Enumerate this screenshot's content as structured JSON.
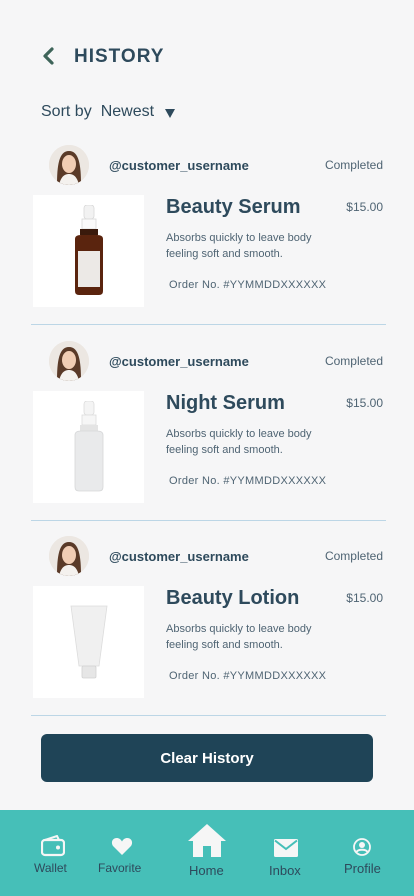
{
  "header": {
    "title": "HISTORY",
    "back_icon": "chevron-left-icon"
  },
  "sort": {
    "label": "Sort by",
    "value": "Newest"
  },
  "orders": [
    {
      "username": "@customer_username",
      "status": "Completed",
      "product_name": "Beauty Serum",
      "price": "$15.00",
      "description": "Absorbs quickly to leave body feeling soft and smooth.",
      "order_no": "Order No. #YYMMDDXXXXXX",
      "product_icon": "amber-dropper-bottle"
    },
    {
      "username": "@customer_username",
      "status": "Completed",
      "product_name": "Night Serum",
      "price": "$15.00",
      "description": "Absorbs quickly to leave body feeling soft and smooth.",
      "order_no": "Order No. #YYMMDDXXXXXX",
      "product_icon": "white-dropper-bottle"
    },
    {
      "username": "@customer_username",
      "status": "Completed",
      "product_name": "Beauty Lotion",
      "price": "$15.00",
      "description": "Absorbs quickly to leave body feeling soft and smooth.",
      "order_no": "Order No. #YYMMDDXXXXXX",
      "product_icon": "lotion-tube"
    }
  ],
  "clear_button": "Clear History",
  "nav": [
    {
      "label": "Wallet",
      "icon": "wallet-icon"
    },
    {
      "label": "Favorite",
      "icon": "heart-icon"
    },
    {
      "label": "Home",
      "icon": "home-icon"
    },
    {
      "label": "Inbox",
      "icon": "mail-icon"
    },
    {
      "label": "Profile",
      "icon": "profile-icon"
    }
  ],
  "colors": {
    "background": "#f6f6f7",
    "text": "#2e4a5c",
    "accent": "#1f4457",
    "nav": "#46bfb8",
    "divider": "#bcd6e6"
  }
}
